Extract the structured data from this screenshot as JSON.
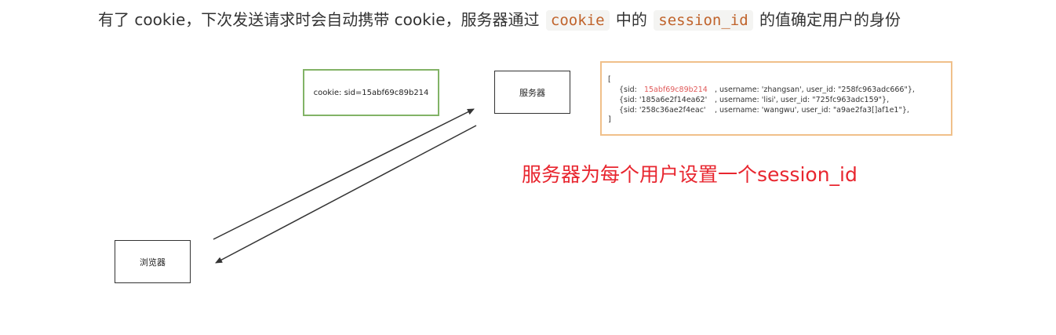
{
  "intro": {
    "text_before": "有了 cookie，下次发送请求时会自动携带 cookie，服务器通过",
    "code_1": "cookie",
    "text_middle": "中的",
    "code_2": "session_id",
    "text_after": "的值确定用户的身份"
  },
  "diagram": {
    "cookie_box": {
      "label": "cookie: sid=15abf69c89b214"
    },
    "server_box": {
      "label": "服务器"
    },
    "browser_box": {
      "label": "浏览器"
    },
    "session_table": {
      "open_bracket": "[",
      "close_bracket": "]",
      "rows": [
        {
          "sid_prefix": "{sid:",
          "sid_value": "15abf69c89b214",
          "rest": ", username: 'zhangsan', user_id: \"258fc963adc666\"},"
        },
        {
          "sid_prefix": "{sid: ",
          "sid_value": "'185a6e2f14ea62'",
          "rest": ", username: 'lisi', user_id: \"725fc963adc159\"},"
        },
        {
          "sid_prefix": "{sid: ",
          "sid_value": "'258c36ae2f4eac'",
          "rest": ", username: 'wangwu', user_id: \"a9ae2fa3[]af1e1\"},"
        }
      ]
    },
    "caption": "服务器为每个用户设置一个session_id"
  },
  "colors": {
    "caption": "#e8262f",
    "sid_highlight": "#e05a5a",
    "code_text": "#c0632b",
    "cookie_border": "#82b366",
    "table_border": "#f0c08a"
  }
}
